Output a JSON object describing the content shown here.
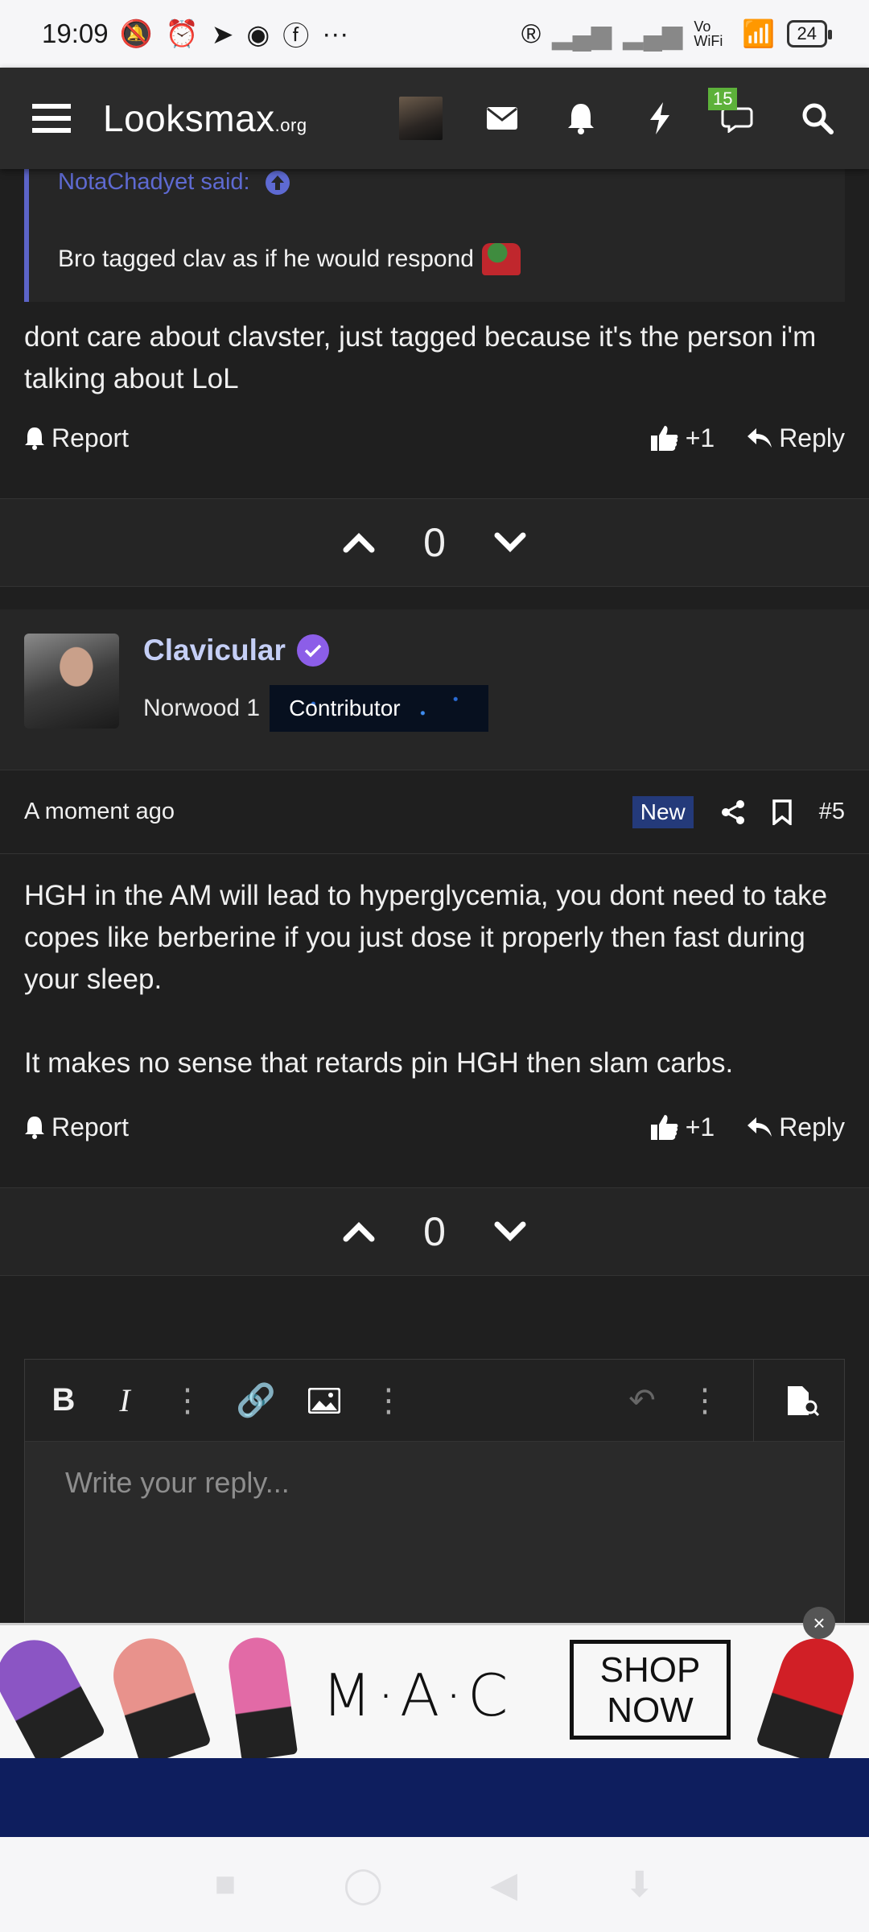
{
  "status_bar": {
    "time": "19:09",
    "battery": "24",
    "network": "Vo WiFi"
  },
  "nav": {
    "logo_main": "Looksmax",
    "logo_suffix": ".org",
    "chat_badge": "15"
  },
  "quote": {
    "attribution": "NotaChadyet said:",
    "text": "Bro tagged clav as if he would respond"
  },
  "post1": {
    "text": "dont care about clavster, just tagged because it's the person i'm talking about LoL",
    "report_label": "Report",
    "like_label": "+1",
    "reply_label": "Reply",
    "score": "0"
  },
  "post2": {
    "username": "Clavicular",
    "user_title": "Norwood 1",
    "banner": "Contributor",
    "time": "A moment ago",
    "new_label": "New",
    "post_number": "#5",
    "paragraph1": "HGH in the AM will lead to hyperglycemia, you dont need to take copes like berberine if you just dose it properly then fast during your sleep.",
    "paragraph2": "It makes no sense that retards pin HGH then slam carbs.",
    "report_label": "Report",
    "like_label": "+1",
    "reply_label": "Reply",
    "score": "0"
  },
  "editor": {
    "placeholder": "Write your reply..."
  },
  "ad": {
    "brand": "M·A·C",
    "cta_line1": "SHOP",
    "cta_line2": "NOW",
    "close": "×"
  }
}
